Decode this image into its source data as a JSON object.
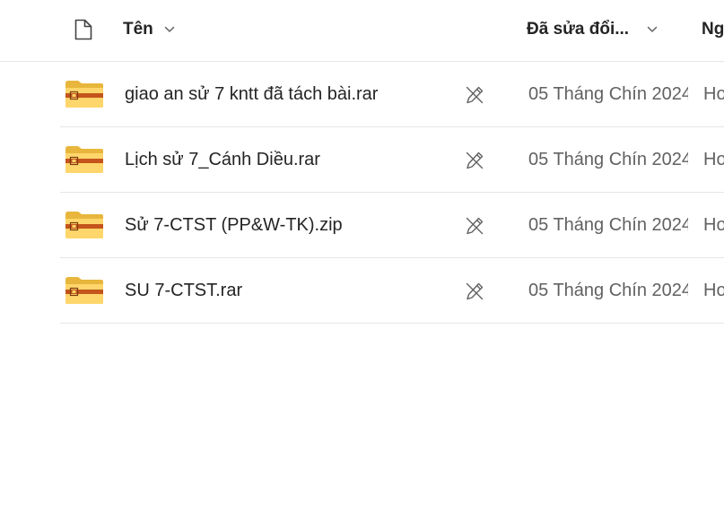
{
  "header": {
    "name_label": "Tên",
    "modified_label": "Đã sửa đổi...",
    "modified_by_label": "Ng"
  },
  "files": [
    {
      "name": "giao an sử 7 kntt đã tách bài.rar",
      "icon": "zip-folder-icon",
      "modified": "05 Tháng Chín 2024",
      "modified_by": "Ho"
    },
    {
      "name": "Lịch sử 7_Cánh Diều.rar",
      "icon": "zip-folder-icon",
      "modified": "05 Tháng Chín 2024",
      "modified_by": "Ho"
    },
    {
      "name": "Sử 7-CTST (PP&W-TK).zip",
      "icon": "zip-folder-icon",
      "modified": "05 Tháng Chín 2024",
      "modified_by": "Ho"
    },
    {
      "name": "SU 7-CTST.rar",
      "icon": "zip-folder-icon",
      "modified": "05 Tháng Chín 2024",
      "modified_by": "Ho"
    }
  ],
  "colors": {
    "folder_back": "#e8b63c",
    "folder_front": "#ffd66b",
    "zip_stripe": "#c4541b",
    "text_primary": "#242424",
    "text_secondary": "#616161",
    "divider": "#e6e6e6"
  }
}
